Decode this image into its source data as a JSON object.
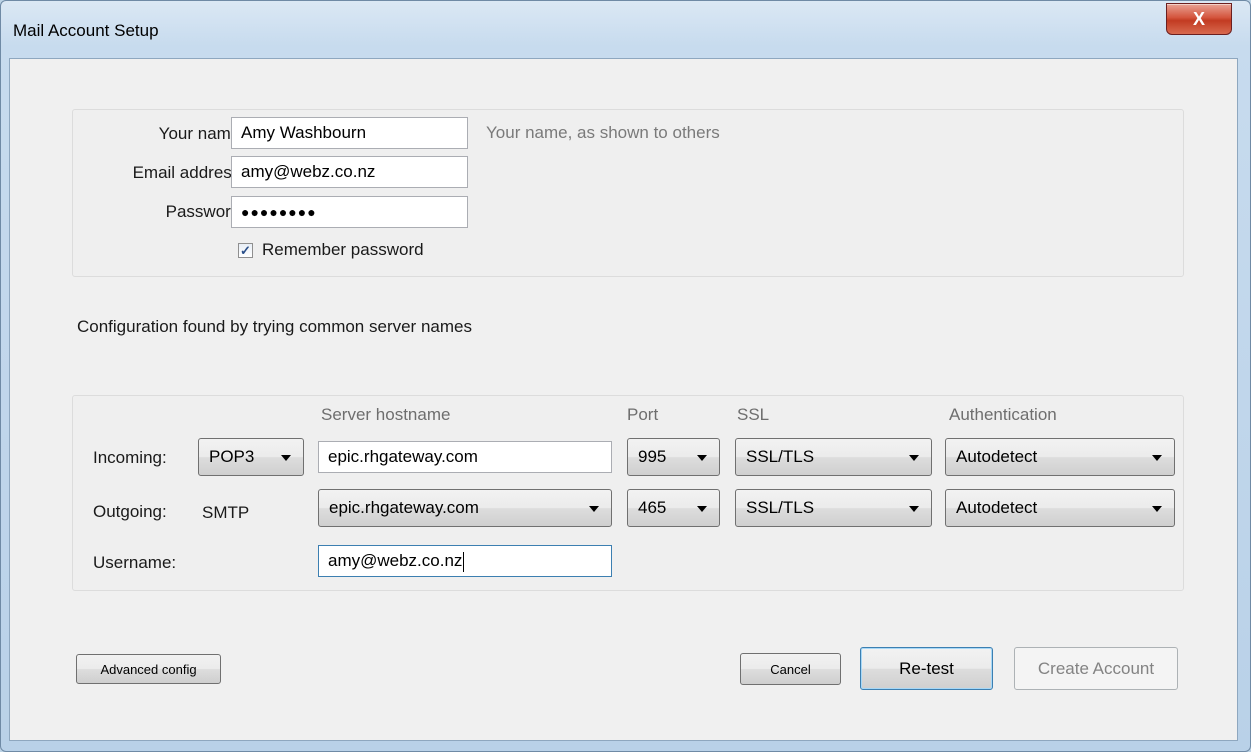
{
  "window": {
    "title": "Mail Account Setup",
    "close_symbol": "X"
  },
  "identity": {
    "name_label": "Your name:",
    "name_value": "Amy Washbourn",
    "name_hint": "Your name, as shown to others",
    "email_label": "Email address:",
    "email_value": "amy@webz.co.nz",
    "password_label": "Password:",
    "password_value": "●●●●●●●●",
    "remember_label": "Remember password",
    "remember_checked": true
  },
  "status_message": "Configuration found by trying common server names",
  "server": {
    "headers": {
      "hostname": "Server hostname",
      "port": "Port",
      "ssl": "SSL",
      "auth": "Authentication"
    },
    "incoming": {
      "label": "Incoming:",
      "protocol": "POP3",
      "hostname": "epic.rhgateway.com",
      "port": "995",
      "ssl": "SSL/TLS",
      "auth": "Autodetect"
    },
    "outgoing": {
      "label": "Outgoing:",
      "protocol": "SMTP",
      "hostname": "epic.rhgateway.com",
      "port": "465",
      "ssl": "SSL/TLS",
      "auth": "Autodetect"
    },
    "username": {
      "label": "Username:",
      "value": "amy@webz.co.nz"
    }
  },
  "buttons": {
    "advanced": "Advanced config",
    "cancel": "Cancel",
    "retest": "Re-test",
    "create": "Create Account"
  }
}
